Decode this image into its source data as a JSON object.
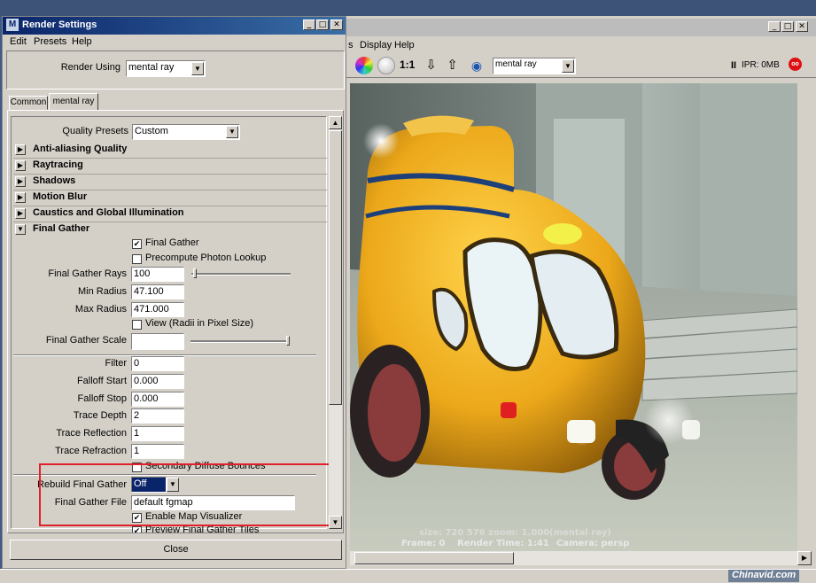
{
  "render_view": {
    "menu": [
      "s",
      "Display",
      "Help"
    ],
    "ratio_label": "1:1",
    "renderer": "mental ray",
    "ipr_label": "IPR: 0MB",
    "status": {
      "line1": "size: 720  576 zoom: 1.000",
      "line1_renderer": "(mental ray)",
      "frame": "Frame: 0",
      "render_time": "Render Time: 1:41",
      "camera": "Camera: persp"
    }
  },
  "render_settings": {
    "title": "Render Settings",
    "menu": [
      "Edit",
      "Presets",
      "Help"
    ],
    "render_using_label": "Render Using",
    "render_using_value": "mental ray",
    "tabs": [
      "Common",
      "mental ray"
    ],
    "quality_presets_label": "Quality Presets",
    "quality_presets_value": "Custom",
    "sections": [
      "Anti-aliasing Quality",
      "Raytracing",
      "Shadows",
      "Motion Blur",
      "Caustics and Global Illumination",
      "Final Gather"
    ],
    "final_gather": {
      "final_gather_label": "Final Gather",
      "precompute_label": "Precompute Photon Lookup",
      "rays_label": "Final Gather Rays",
      "rays_value": "100",
      "min_radius_label": "Min Radius",
      "min_radius_value": "47.100",
      "max_radius_label": "Max Radius",
      "max_radius_value": "471.000",
      "view_label": "View (Radii in Pixel Size)",
      "scale_label": "Final Gather Scale",
      "filter_label": "Filter",
      "filter_value": "0",
      "falloff_start_label": "Falloff Start",
      "falloff_start_value": "0.000",
      "falloff_stop_label": "Falloff Stop",
      "falloff_stop_value": "0.000",
      "trace_depth_label": "Trace Depth",
      "trace_depth_value": "2",
      "trace_reflection_label": "Trace Reflection",
      "trace_reflection_value": "1",
      "trace_refraction_label": "Trace Refraction",
      "trace_refraction_value": "1",
      "secondary_label": "Secondary Diffuse Bounces",
      "rebuild_label": "Rebuild Final Gather",
      "rebuild_value": "Off",
      "file_label": "Final Gather File",
      "file_value": "default fgmap",
      "map_vis_label": "Enable Map Visualizer",
      "preview_tiles_label": "Preview Final Gather Tiles"
    },
    "close_label": "Close"
  },
  "watermark": "Chinavid.com",
  "colors": {
    "highlight_box": "#e0202a",
    "taskbar": "#3f5a86",
    "title_active": "#0a246a"
  }
}
